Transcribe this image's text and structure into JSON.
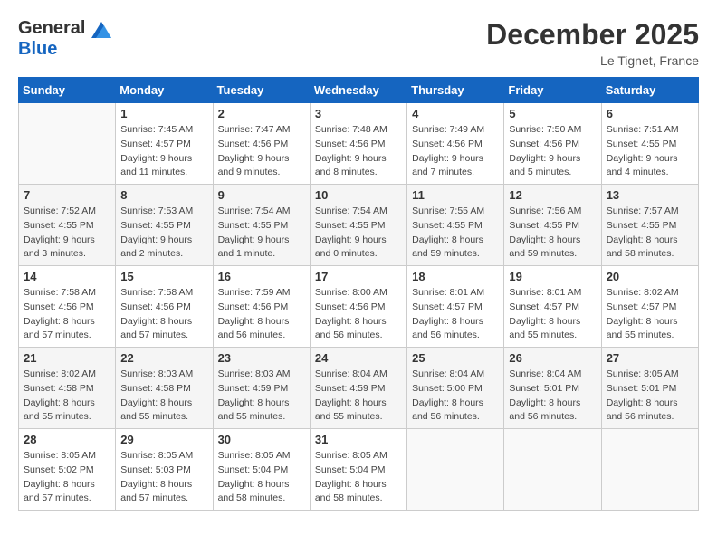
{
  "header": {
    "logo_general": "General",
    "logo_blue": "Blue",
    "month_title": "December 2025",
    "location": "Le Tignet, France"
  },
  "weekdays": [
    "Sunday",
    "Monday",
    "Tuesday",
    "Wednesday",
    "Thursday",
    "Friday",
    "Saturday"
  ],
  "weeks": [
    [
      {
        "day": "",
        "info": ""
      },
      {
        "day": "1",
        "info": "Sunrise: 7:45 AM\nSunset: 4:57 PM\nDaylight: 9 hours\nand 11 minutes."
      },
      {
        "day": "2",
        "info": "Sunrise: 7:47 AM\nSunset: 4:56 PM\nDaylight: 9 hours\nand 9 minutes."
      },
      {
        "day": "3",
        "info": "Sunrise: 7:48 AM\nSunset: 4:56 PM\nDaylight: 9 hours\nand 8 minutes."
      },
      {
        "day": "4",
        "info": "Sunrise: 7:49 AM\nSunset: 4:56 PM\nDaylight: 9 hours\nand 7 minutes."
      },
      {
        "day": "5",
        "info": "Sunrise: 7:50 AM\nSunset: 4:56 PM\nDaylight: 9 hours\nand 5 minutes."
      },
      {
        "day": "6",
        "info": "Sunrise: 7:51 AM\nSunset: 4:55 PM\nDaylight: 9 hours\nand 4 minutes."
      }
    ],
    [
      {
        "day": "7",
        "info": "Sunrise: 7:52 AM\nSunset: 4:55 PM\nDaylight: 9 hours\nand 3 minutes."
      },
      {
        "day": "8",
        "info": "Sunrise: 7:53 AM\nSunset: 4:55 PM\nDaylight: 9 hours\nand 2 minutes."
      },
      {
        "day": "9",
        "info": "Sunrise: 7:54 AM\nSunset: 4:55 PM\nDaylight: 9 hours\nand 1 minute."
      },
      {
        "day": "10",
        "info": "Sunrise: 7:54 AM\nSunset: 4:55 PM\nDaylight: 9 hours\nand 0 minutes."
      },
      {
        "day": "11",
        "info": "Sunrise: 7:55 AM\nSunset: 4:55 PM\nDaylight: 8 hours\nand 59 minutes."
      },
      {
        "day": "12",
        "info": "Sunrise: 7:56 AM\nSunset: 4:55 PM\nDaylight: 8 hours\nand 59 minutes."
      },
      {
        "day": "13",
        "info": "Sunrise: 7:57 AM\nSunset: 4:55 PM\nDaylight: 8 hours\nand 58 minutes."
      }
    ],
    [
      {
        "day": "14",
        "info": "Sunrise: 7:58 AM\nSunset: 4:56 PM\nDaylight: 8 hours\nand 57 minutes."
      },
      {
        "day": "15",
        "info": "Sunrise: 7:58 AM\nSunset: 4:56 PM\nDaylight: 8 hours\nand 57 minutes."
      },
      {
        "day": "16",
        "info": "Sunrise: 7:59 AM\nSunset: 4:56 PM\nDaylight: 8 hours\nand 56 minutes."
      },
      {
        "day": "17",
        "info": "Sunrise: 8:00 AM\nSunset: 4:56 PM\nDaylight: 8 hours\nand 56 minutes."
      },
      {
        "day": "18",
        "info": "Sunrise: 8:01 AM\nSunset: 4:57 PM\nDaylight: 8 hours\nand 56 minutes."
      },
      {
        "day": "19",
        "info": "Sunrise: 8:01 AM\nSunset: 4:57 PM\nDaylight: 8 hours\nand 55 minutes."
      },
      {
        "day": "20",
        "info": "Sunrise: 8:02 AM\nSunset: 4:57 PM\nDaylight: 8 hours\nand 55 minutes."
      }
    ],
    [
      {
        "day": "21",
        "info": "Sunrise: 8:02 AM\nSunset: 4:58 PM\nDaylight: 8 hours\nand 55 minutes."
      },
      {
        "day": "22",
        "info": "Sunrise: 8:03 AM\nSunset: 4:58 PM\nDaylight: 8 hours\nand 55 minutes."
      },
      {
        "day": "23",
        "info": "Sunrise: 8:03 AM\nSunset: 4:59 PM\nDaylight: 8 hours\nand 55 minutes."
      },
      {
        "day": "24",
        "info": "Sunrise: 8:04 AM\nSunset: 4:59 PM\nDaylight: 8 hours\nand 55 minutes."
      },
      {
        "day": "25",
        "info": "Sunrise: 8:04 AM\nSunset: 5:00 PM\nDaylight: 8 hours\nand 56 minutes."
      },
      {
        "day": "26",
        "info": "Sunrise: 8:04 AM\nSunset: 5:01 PM\nDaylight: 8 hours\nand 56 minutes."
      },
      {
        "day": "27",
        "info": "Sunrise: 8:05 AM\nSunset: 5:01 PM\nDaylight: 8 hours\nand 56 minutes."
      }
    ],
    [
      {
        "day": "28",
        "info": "Sunrise: 8:05 AM\nSunset: 5:02 PM\nDaylight: 8 hours\nand 57 minutes."
      },
      {
        "day": "29",
        "info": "Sunrise: 8:05 AM\nSunset: 5:03 PM\nDaylight: 8 hours\nand 57 minutes."
      },
      {
        "day": "30",
        "info": "Sunrise: 8:05 AM\nSunset: 5:04 PM\nDaylight: 8 hours\nand 58 minutes."
      },
      {
        "day": "31",
        "info": "Sunrise: 8:05 AM\nSunset: 5:04 PM\nDaylight: 8 hours\nand 58 minutes."
      },
      {
        "day": "",
        "info": ""
      },
      {
        "day": "",
        "info": ""
      },
      {
        "day": "",
        "info": ""
      }
    ]
  ]
}
